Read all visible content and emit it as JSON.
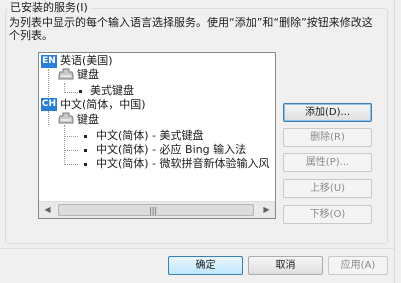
{
  "group": {
    "title": "已安装的服务(I)",
    "description": "为列表中显示的每个输入语言选择服务。使用“添加”和“删除”按钮来修改这个列表。"
  },
  "tree": {
    "nodes": [
      {
        "badge": "EN",
        "label": "英语(美国)"
      },
      {
        "label": "键盘"
      },
      {
        "label": "美式键盘"
      },
      {
        "badge": "CH",
        "label": "中文(简体，中国)"
      },
      {
        "label": "键盘"
      },
      {
        "label": "中文(简体) - 美式键盘"
      },
      {
        "label": "中文(简体) - 必应 Bing 输入法"
      },
      {
        "label": "中文(简体) - 微软拼音新体验输入风"
      }
    ],
    "scroll_grip": "|||"
  },
  "side_buttons": {
    "add": "添加(D)...",
    "remove": "删除(R)",
    "properties": "属性(P)...",
    "move_up": "上移(U)",
    "move_down": "下移(O)"
  },
  "dialog_buttons": {
    "ok": "确定",
    "cancel": "取消",
    "apply": "应用(A)"
  },
  "icons": {
    "lang_badge_color": "#2a7fd4",
    "keyboard": "keyboard-icon",
    "scroll_left": "◀",
    "scroll_right": "▶"
  }
}
